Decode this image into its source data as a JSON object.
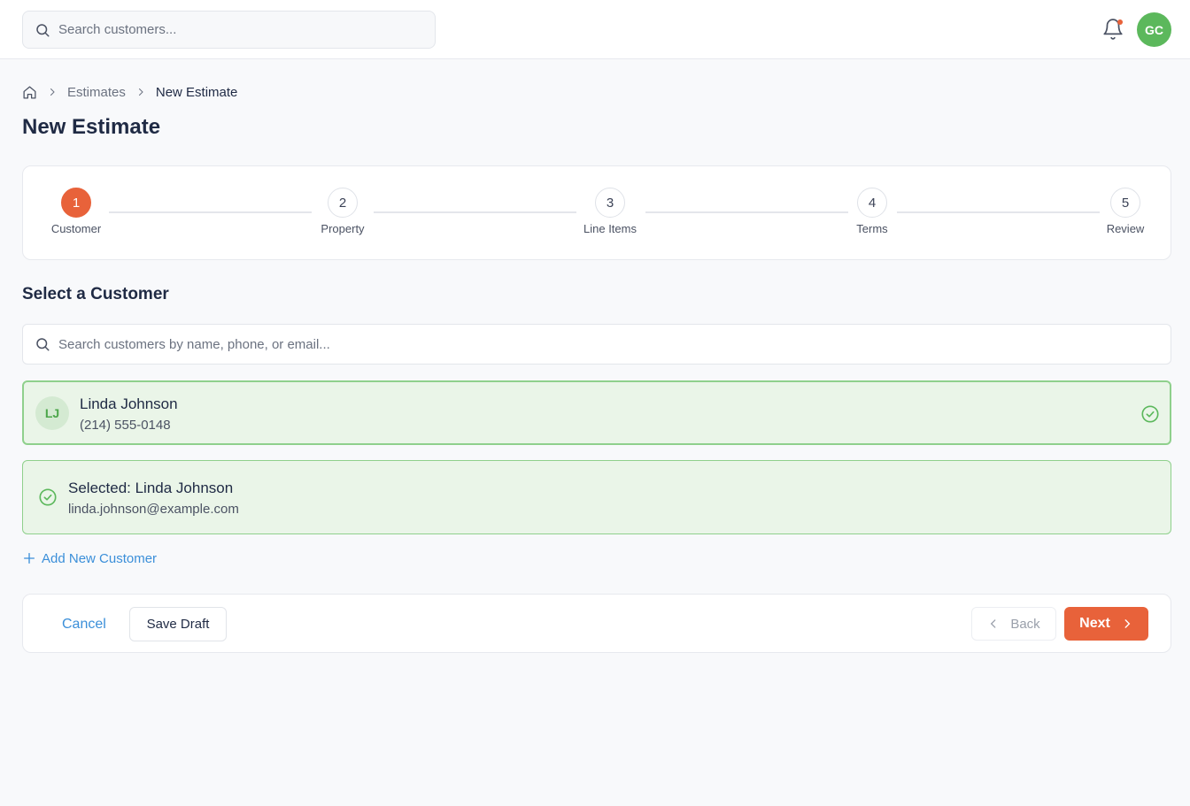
{
  "colors": {
    "accent": "#e8623a",
    "success": "#5cb85c",
    "link": "#3b8fd9",
    "text": "#1f2a44"
  },
  "header": {
    "search_placeholder": "Search customers...",
    "search_icon": "search-icon",
    "notification_icon": "bell-icon",
    "user_initials": "GC"
  },
  "breadcrumb": {
    "home_icon": "home-icon",
    "items": [
      "Estimates",
      "New Estimate"
    ]
  },
  "page": {
    "title": "New Estimate"
  },
  "stepper": {
    "current": 1,
    "steps": [
      {
        "number": "1",
        "label": "Customer"
      },
      {
        "number": "2",
        "label": "Property"
      },
      {
        "number": "3",
        "label": "Line Items"
      },
      {
        "number": "4",
        "label": "Terms"
      },
      {
        "number": "5",
        "label": "Review"
      }
    ]
  },
  "customer_section": {
    "title": "Select a Customer",
    "search_placeholder": "Search customers by name, phone, or email...",
    "results": [
      {
        "initials": "LJ",
        "name": "Linda Johnson",
        "phone": "(214) 555-0148",
        "selected": true
      }
    ],
    "selected": {
      "title": "Selected: Linda Johnson",
      "email": "linda.johnson@example.com"
    },
    "add_new_label": "Add New Customer"
  },
  "footer": {
    "cancel_label": "Cancel",
    "save_draft_label": "Save Draft",
    "back_label": "Back",
    "next_label": "Next"
  }
}
